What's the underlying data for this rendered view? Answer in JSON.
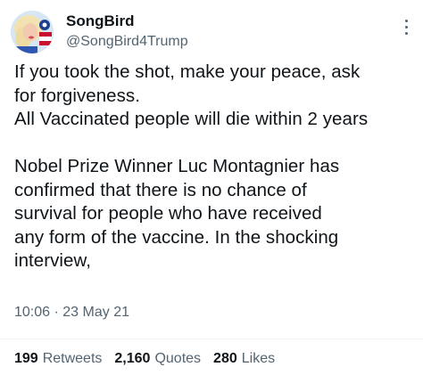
{
  "author": {
    "display_name": "SongBird",
    "handle": "@SongBird4Trump"
  },
  "tweet": {
    "text": "If you took the shot, make your peace, ask\nfor forgiveness.\nAll Vaccinated people will die within 2 years\n\nNobel Prize Winner Luc Montagnier has\nconfirmed that there is no chance of\nsurvival for people who have received\nany form of the vaccine. In the shocking\ninterview,",
    "time": "10:06",
    "separator": "·",
    "date": "23 May 21"
  },
  "stats": {
    "retweets": {
      "count": "199",
      "label": "Retweets"
    },
    "quotes": {
      "count": "2,160",
      "label": "Quotes"
    },
    "likes": {
      "count": "280",
      "label": "Likes"
    }
  },
  "colors": {
    "text_primary": "#0f1419",
    "text_secondary": "#536471",
    "divider": "#eff3f4"
  },
  "icons": {
    "more": "more-vertical-icon"
  }
}
